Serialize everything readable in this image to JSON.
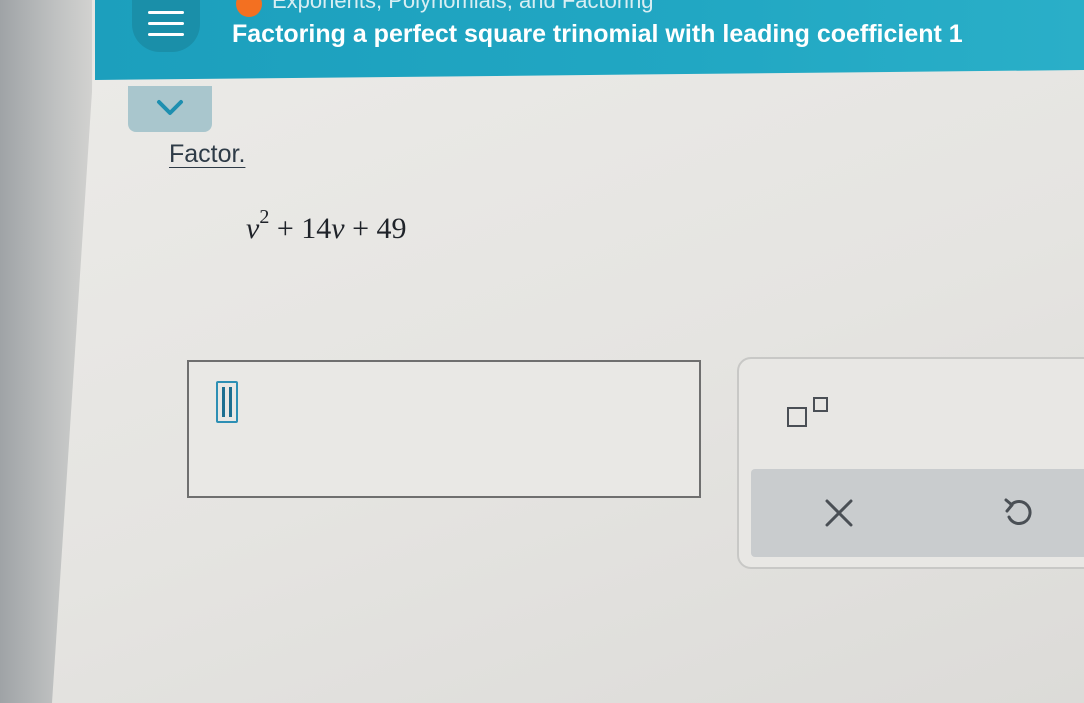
{
  "header": {
    "breadcrumb": "Exponents, Polynomials, and Factoring",
    "title": "Factoring a perfect square trinomial with leading coefficient 1",
    "accent_color": "#21a7c3",
    "status_dot_color": "#f37021",
    "menu_icon": "hamburger-icon"
  },
  "question": {
    "collapse_icon": "chevron-down-icon",
    "instruction": "Factor.",
    "expression": {
      "var1": "v",
      "exp": "2",
      "rest_a": " + 14",
      "var2": "v",
      "rest_b": " + 49"
    }
  },
  "answer": {
    "value": "",
    "cursor_icon": "text-cursor-icon"
  },
  "keypad": {
    "exponent_icon": "superscript-icon",
    "clear_icon": "close-icon",
    "undo_icon": "undo-icon"
  }
}
